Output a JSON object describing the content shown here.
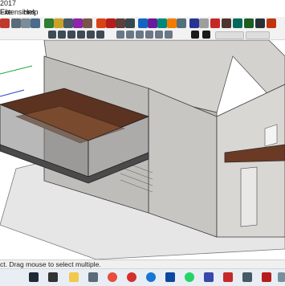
{
  "window": {
    "title": "2017"
  },
  "menu": {
    "items": [
      "File",
      "Extensions",
      "Help"
    ]
  },
  "toolbar": {
    "tools_row1": [
      "paint-bucket-icon",
      "zoom-icon",
      "zoom-window-icon",
      "zoom-extents-icon",
      "orbit-icon",
      "pan-icon",
      "select-icon",
      "eraser-icon",
      "pencil-icon",
      "line-icon",
      "arc-icon",
      "rectangle-icon",
      "circle-icon",
      "push-pull-icon",
      "move-icon",
      "rotate-icon",
      "scale-icon",
      "offset-icon",
      "tape-measure-icon",
      "text-icon"
    ],
    "tools_row2": [
      "iso-view-icon",
      "top-view-icon",
      "front-view-icon",
      "right-view-icon",
      "back-view-icon",
      "left-view-icon",
      "xray-icon",
      "wireframe-icon",
      "hidden-line-icon",
      "shaded-icon",
      "textured-icon",
      "monochrome-icon"
    ]
  },
  "status": {
    "text": "ct. Drag mouse to select multiple."
  },
  "taskbar": {
    "icons": [
      "task-view-icon",
      "file-explorer-icon",
      "store-icon",
      "chrome-icon",
      "opera-icon",
      "edge-icon",
      "mail-icon",
      "whatsapp-icon",
      "photos-icon",
      "media-icon",
      "sketchup-icon",
      "terminal-icon",
      "browser-icon",
      "settings-icon",
      "app-icon"
    ]
  },
  "colors": {
    "accent": "#0078d7",
    "wood": "#6b3a24",
    "wall": "#c8c6c2"
  }
}
